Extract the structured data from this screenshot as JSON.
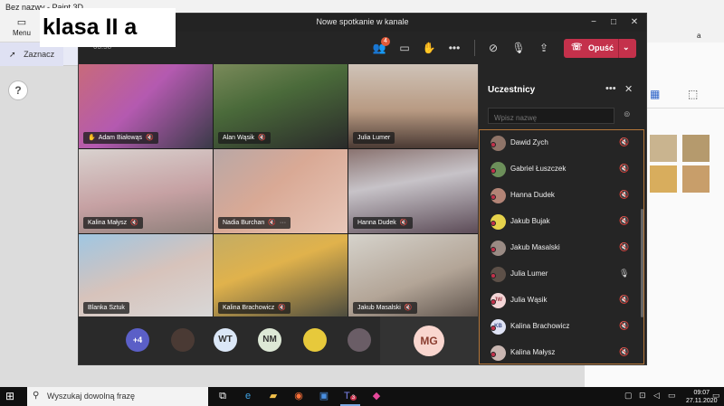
{
  "paint": {
    "window_title": "Bez nazwy - Paint 3D",
    "menu_label": "Menu",
    "select_label": "Zaznacz",
    "right_label": "a",
    "help_label": "?"
  },
  "overlay": {
    "label": "klasa II a"
  },
  "teams": {
    "window_title": "Nowe spotkanie w kanale",
    "call_time": "03:58",
    "participants_badge": "4",
    "leave_label": "Opuść",
    "tiles": [
      {
        "name": "Adam Białowąs",
        "hand_raised": true
      },
      {
        "name": "Alan Wąsik"
      },
      {
        "name": "Julia Lumer"
      },
      {
        "name": "Kalina Małysz"
      },
      {
        "name": "Nadia Burchan",
        "more": "···"
      },
      {
        "name": "Hanna Dudek"
      },
      {
        "name": "Blanka Sztuk"
      },
      {
        "name": "Kalina Brachowicz"
      },
      {
        "name": "Jakub Masalski"
      }
    ],
    "overflow": {
      "more_count": "+4",
      "avatars": [
        "WT",
        "NM"
      ],
      "self_initials": "MG"
    },
    "panel": {
      "title": "Uczestnicy",
      "search_placeholder": "Wpisz nazwę",
      "participants": [
        {
          "name": "Dawid Zych",
          "initials": "",
          "mic": "muted"
        },
        {
          "name": "Gabriel Łuszczek",
          "initials": "",
          "mic": "muted"
        },
        {
          "name": "Hanna Dudek",
          "initials": "",
          "mic": "muted"
        },
        {
          "name": "Jakub Bujak",
          "initials": "",
          "mic": "muted"
        },
        {
          "name": "Jakub Masalski",
          "initials": "",
          "mic": "muted"
        },
        {
          "name": "Julia Lumer",
          "initials": "",
          "mic": "on"
        },
        {
          "name": "Julia Wąsik",
          "initials": "JW",
          "mic": "muted"
        },
        {
          "name": "Kalina Brachowicz",
          "initials": "KB",
          "mic": "muted"
        },
        {
          "name": "Kalina Małysz",
          "initials": "",
          "mic": "muted"
        }
      ]
    }
  },
  "taskbar": {
    "search_placeholder": "Wyszukaj dowolną frazę",
    "time": "09:07",
    "date": "27.11.2020",
    "teams_badge": "3"
  }
}
